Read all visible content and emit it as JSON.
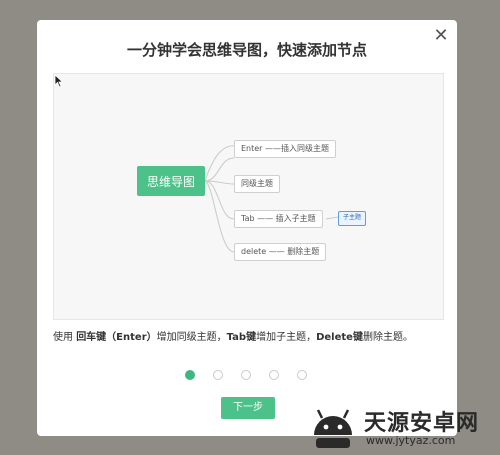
{
  "dialog": {
    "title": "一分钟学会思维导图，快速添加节点",
    "close_glyph": "✕"
  },
  "demo": {
    "root": "思维导图",
    "branches": [
      "Enter ——插入同级主题",
      "同级主题",
      "Tab —— 插入子主题",
      "delete —— 删除主题"
    ],
    "child": "子主题"
  },
  "description": {
    "p1": "使用 ",
    "b1": "回车键（Enter）",
    "p2": "增加同级主题，",
    "b2": "Tab键",
    "p3": "增加子主题，",
    "b3": "Delete键",
    "p4": "删除主题。"
  },
  "pagination": {
    "total": 5,
    "current": 1
  },
  "next_button": "下一步",
  "watermark": {
    "text": "天源安卓网",
    "url": "www.jytyaz.com"
  },
  "colors": {
    "accent": "#4cc18a",
    "overlay": "#8f8c86",
    "child_border": "#5aa0e6"
  }
}
